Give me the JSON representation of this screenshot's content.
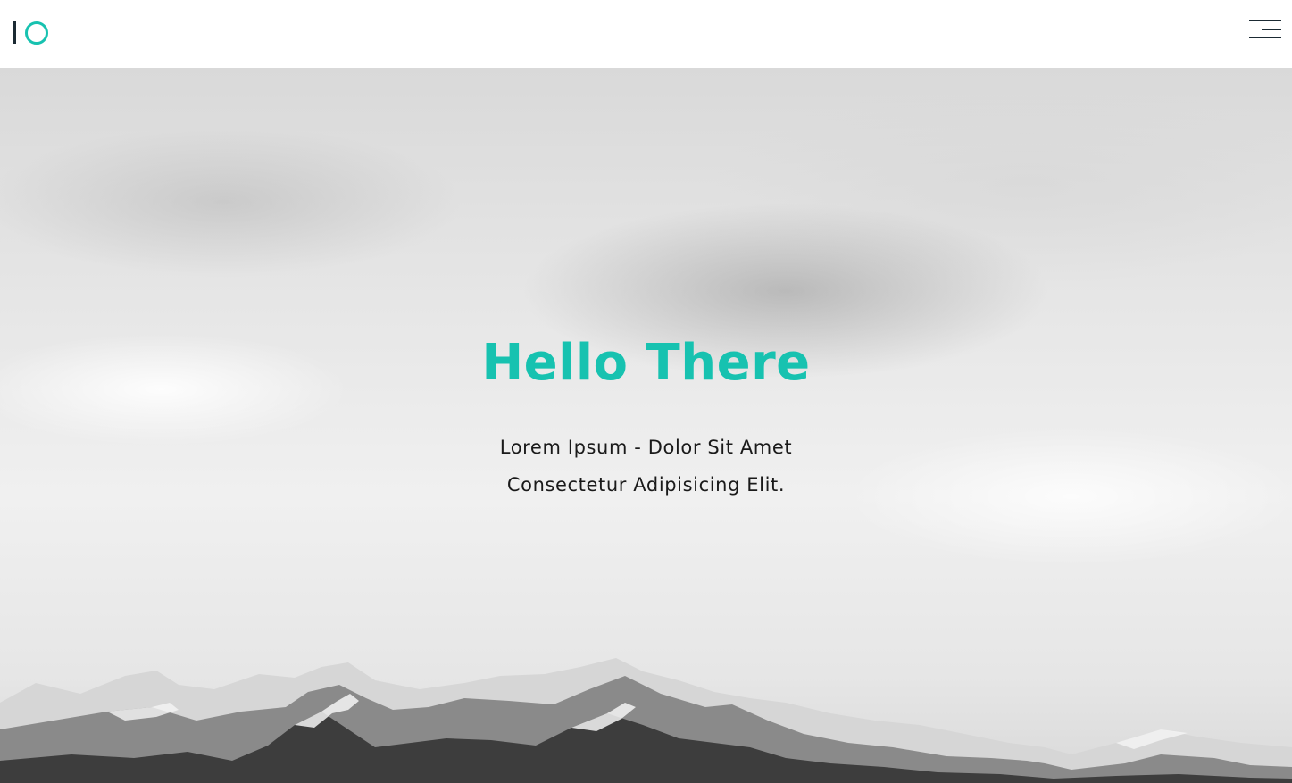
{
  "brand": {
    "logo_icon": "io-logo-icon",
    "accent_color": "#17c2b0",
    "dark_color": "#1b2a33"
  },
  "header": {
    "menu_icon": "hamburger-menu-icon"
  },
  "hero": {
    "title": "Hello There",
    "subtitle_line1": "Lorem Ipsum - Dolor Sit Amet",
    "subtitle_line2": "Consectetur Adipisicing Elit.",
    "background": "snowy-mountains-cloudy-sky-image"
  }
}
